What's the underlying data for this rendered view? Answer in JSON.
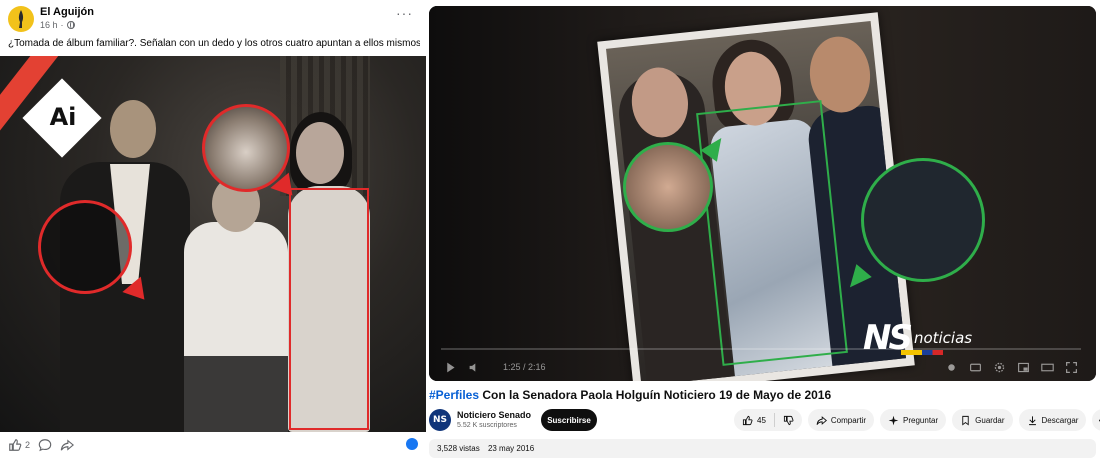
{
  "facebook": {
    "page_name": "El Aguijón",
    "timestamp": "16 h",
    "privacy_icon": "globe-icon",
    "caption": "¿Tomada de álbum familiar?. Señalan con un dedo y los otros cuatro apuntan a ellos mismos.",
    "badge": "Ai",
    "like_count": "2",
    "footer_icons": [
      "like-icon",
      "comment-icon",
      "share-icon"
    ],
    "accent": "#e02a2a"
  },
  "youtube": {
    "player": {
      "time": "1:25 / 2:16",
      "logo": {
        "mark": "NS",
        "word": "noticias"
      }
    },
    "title": {
      "hashtag": "#Perfiles",
      "text": "Con la Senadora Paola Holguín Noticiero 19 de Mayo de 2016"
    },
    "channel": {
      "avatar": "NS",
      "name": "Noticiero Senado",
      "subscribers": "5.52 K suscriptores"
    },
    "subscribe_label": "Suscribirse",
    "likes": "45",
    "share_label": "Compartir",
    "ask_label": "Preguntar",
    "save_label": "Guardar",
    "download_label": "Descargar",
    "views": "3,528 vistas",
    "date": "23 may 2016",
    "accent": "#2fae4a",
    "link_color": "#065fd4"
  }
}
